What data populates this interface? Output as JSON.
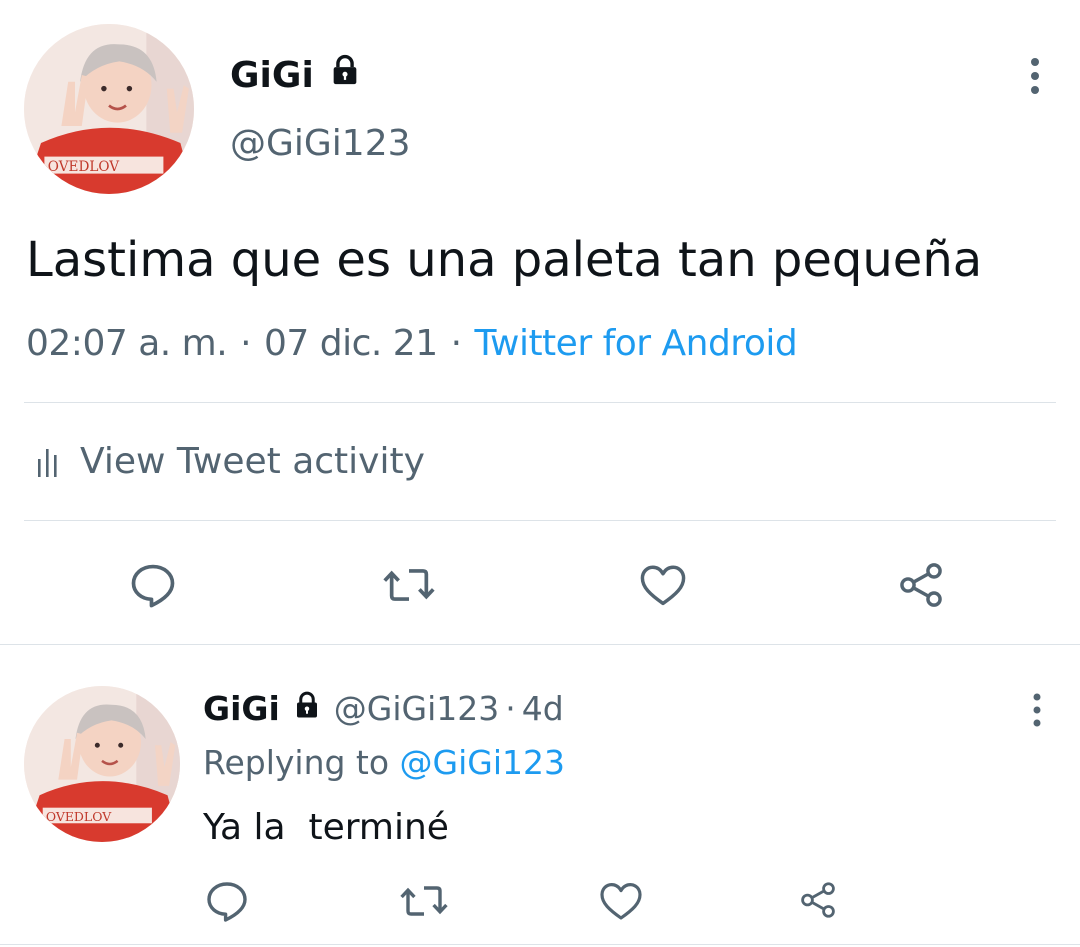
{
  "main_tweet": {
    "author_name": "GiGi",
    "author_handle": "@GiGi123",
    "text": "Lastima que es una paleta tan pequeña",
    "time": "02:07 a. m.",
    "separator": "·",
    "date": "07 dic. 21",
    "source": "Twitter for Android",
    "activity_label": "View Tweet activity",
    "actions": [
      "reply-icon",
      "retweet-icon",
      "like-icon",
      "share-icon"
    ]
  },
  "reply": {
    "author_name": "GiGi",
    "author_handle": "@GiGi123",
    "separator": "·",
    "age": "4d",
    "replying_prefix": "Replying to",
    "replying_to": "@GiGi123",
    "text": "Ya la  terminé",
    "actions": [
      "reply-icon",
      "retweet-icon",
      "like-icon",
      "share-icon"
    ]
  },
  "colors": {
    "text": "#0f1419",
    "secondary": "#536471",
    "link": "#1d9bf0",
    "divider": "#dde3e8"
  }
}
